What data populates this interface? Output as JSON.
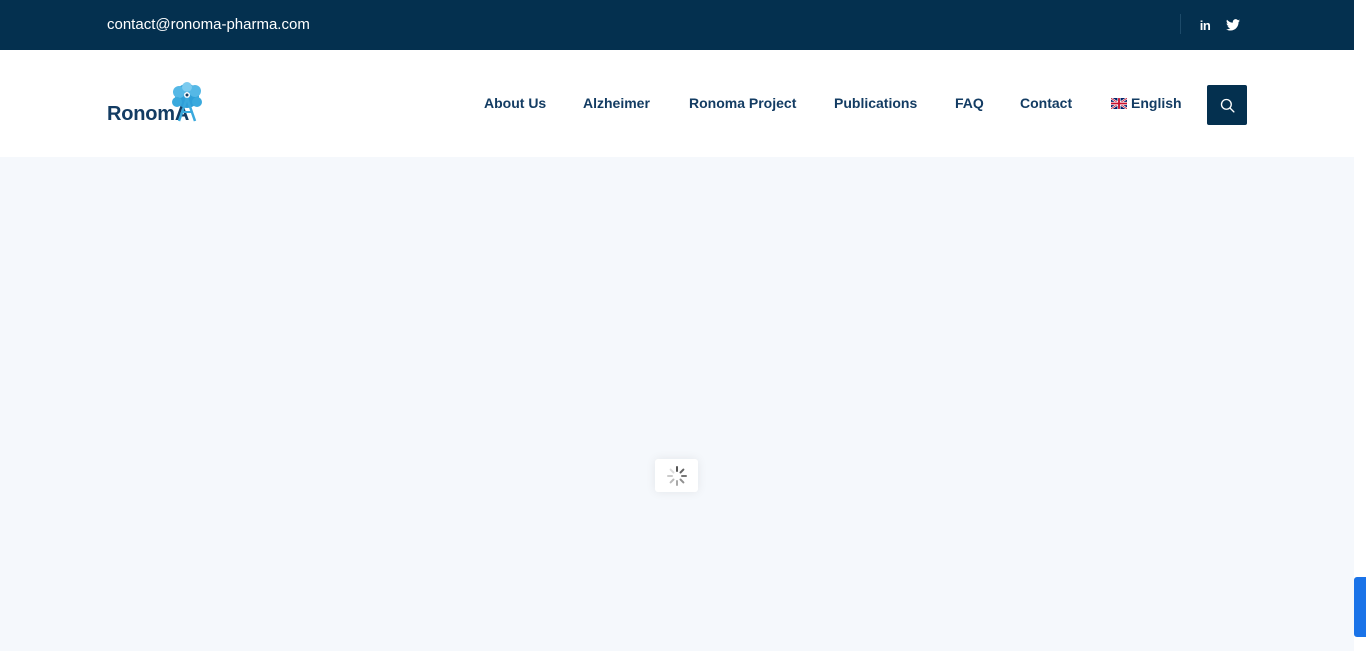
{
  "topbar": {
    "email": "contact@ronoma-pharma.com",
    "social": [
      {
        "icon": "linkedin-icon",
        "label": "in"
      },
      {
        "icon": "twitter-icon"
      }
    ]
  },
  "header": {
    "logo_text": "RonomA",
    "nav": [
      {
        "label": "About Us"
      },
      {
        "label": "Alzheimer"
      },
      {
        "label": "Ronoma Project"
      },
      {
        "label": "Publications"
      },
      {
        "label": "FAQ"
      },
      {
        "label": "Contact"
      },
      {
        "label": "English",
        "icon": "uk-flag-icon"
      }
    ],
    "search_icon": "search-icon"
  },
  "colors": {
    "topbar_bg": "#04304f",
    "nav_text": "#133c63",
    "content_bg": "#f5f8fc",
    "logo_accent": "#3aa9dd",
    "side_tab": "#1a73e8"
  },
  "content": {
    "state": "loading",
    "loader_icon": "spinner-icon"
  }
}
